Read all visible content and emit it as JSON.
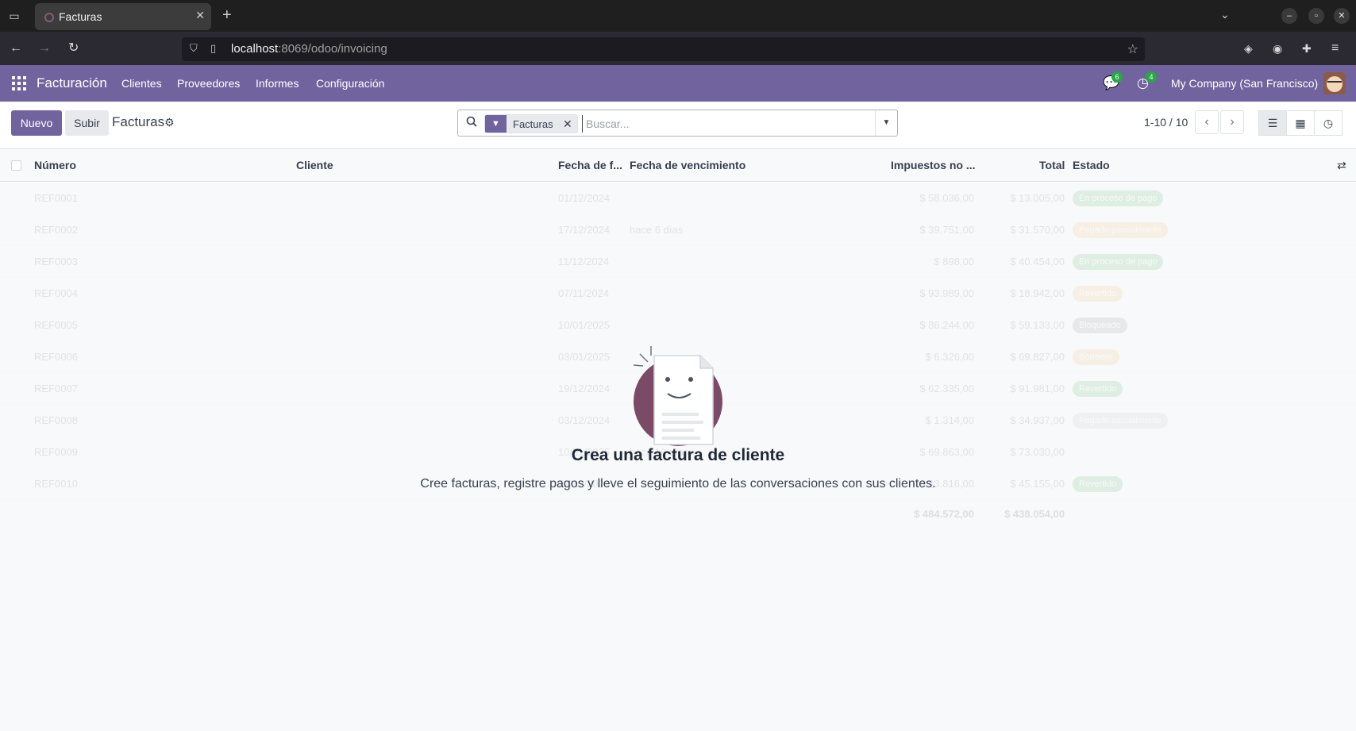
{
  "browser": {
    "tab_title": "Facturas",
    "url_host": "localhost",
    "url_rest": ":8069/odoo/invoicing"
  },
  "app": {
    "name": "Facturación",
    "menu": [
      "Clientes",
      "Proveedores",
      "Informes",
      "Configuración"
    ],
    "messages_count": "6",
    "activities_count": "4",
    "company": "My Company (San Francisco)",
    "brand_color": "#71639e"
  },
  "control": {
    "new_label": "Nuevo",
    "upload_label": "Subir",
    "breadcrumb": "Facturas",
    "facet_label": "Facturas",
    "search_placeholder": "Buscar...",
    "pager": "1-10 / 10"
  },
  "columns": {
    "number": "Número",
    "client": "Cliente",
    "invoice_date": "Fecha de f...",
    "due_date": "Fecha de vencimiento",
    "untaxed": "Impuestos no ...",
    "total": "Total",
    "status": "Estado"
  },
  "rows": [
    {
      "number": "REF0001",
      "date": "01/12/2024",
      "due": "",
      "untaxed": "$ 58.036,00",
      "total": "$ 13.005,00",
      "status": "En proceso de pago",
      "status_color": "#28a745"
    },
    {
      "number": "REF0002",
      "date": "17/12/2024",
      "due": "hace 6 días",
      "untaxed": "$ 39.751,00",
      "total": "$ 31.570,00",
      "status": "Pagado parcialmente",
      "status_color": "#f0ad4e"
    },
    {
      "number": "REF0003",
      "date": "11/12/2024",
      "due": "",
      "untaxed": "$ 898,00",
      "total": "$ 40.454,00",
      "status": "En proceso de pago",
      "status_color": "#28a745"
    },
    {
      "number": "REF0004",
      "date": "07/11/2024",
      "due": "",
      "untaxed": "$ 93.989,00",
      "total": "$ 18.942,00",
      "status": "Revertido",
      "status_color": "#f0ad4e"
    },
    {
      "number": "REF0005",
      "date": "10/01/2025",
      "due": "",
      "untaxed": "$ 86.244,00",
      "total": "$ 59.133,00",
      "status": "Bloqueado",
      "status_color": "#6c757d"
    },
    {
      "number": "REF0006",
      "date": "03/01/2025",
      "due": "",
      "untaxed": "$ 6.326,00",
      "total": "$ 69.827,00",
      "status": "Borrador",
      "status_color": "#f0ad4e"
    },
    {
      "number": "REF0007",
      "date": "19/12/2024",
      "due": "",
      "untaxed": "$ 62.335,00",
      "total": "$ 91.981,00",
      "status": "Revertido",
      "status_color": "#28a745"
    },
    {
      "number": "REF0008",
      "date": "03/12/2024",
      "due": "",
      "untaxed": "$ 1.314,00",
      "total": "$ 34.937,00",
      "status": "Pagado parcialmente",
      "status_color": "#adb5bd"
    },
    {
      "number": "REF0009",
      "date": "10/01/2025",
      "due": "hace 16 días",
      "untaxed": "$ 69.863,00",
      "total": "$ 73.030,00",
      "status": "",
      "status_color": ""
    },
    {
      "number": "REF0010",
      "date": "22/12/2024",
      "due": "",
      "untaxed": "$ 63.816,00",
      "total": "$ 45.155,00",
      "status": "Revertido",
      "status_color": "#28a745"
    }
  ],
  "totals": {
    "untaxed": "$ 484.572,00",
    "total": "$ 438.054,00"
  },
  "helper": {
    "title": "Crea una factura de cliente",
    "text": "Cree facturas, registre pagos y lleve el seguimiento de las conversaciones con sus clientes."
  }
}
